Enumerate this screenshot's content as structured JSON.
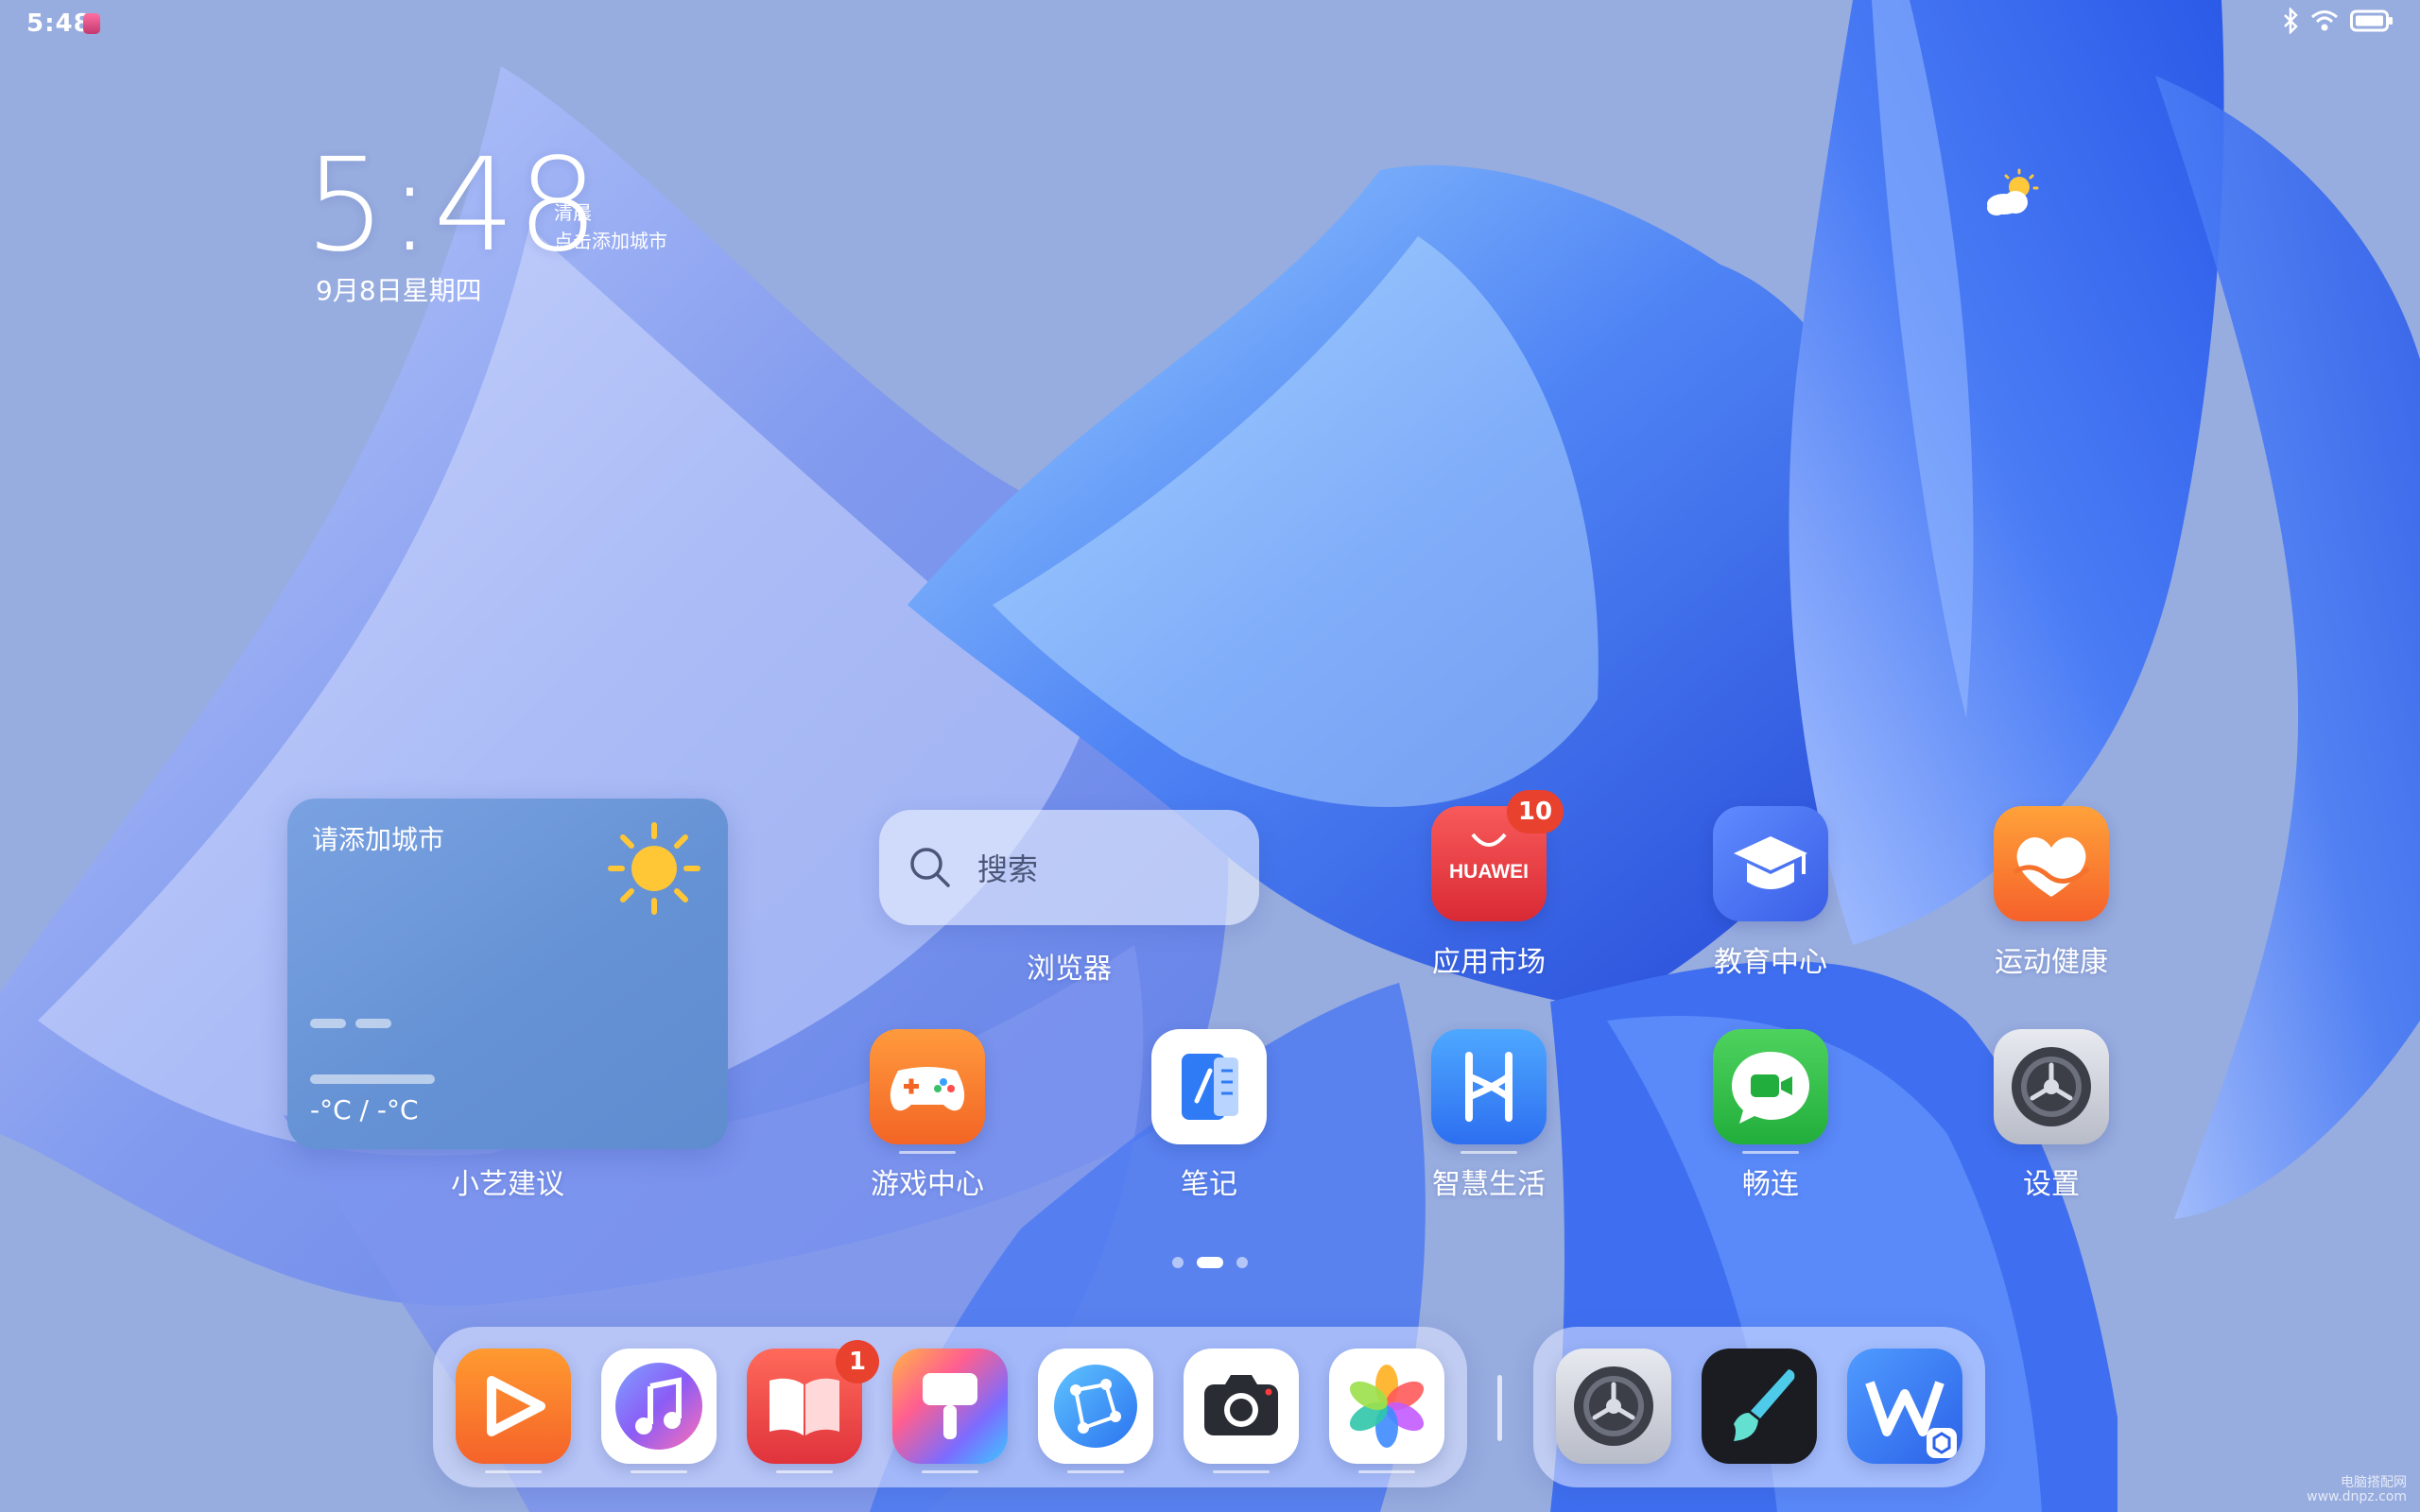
{
  "status_bar": {
    "time": "5:48"
  },
  "clock_widget": {
    "time": "5:48",
    "weather_condition": "清晨",
    "add_city_prompt": "点击添加城市",
    "date": "9月8日星期四"
  },
  "weather_card": {
    "city_prompt": "请添加城市",
    "temperature": "-°C / -°C",
    "label": "小艺建议"
  },
  "search_widget": {
    "placeholder": "搜索",
    "label": "浏览器"
  },
  "apps": {
    "app_market": {
      "label": "应用市场",
      "badge": "10",
      "brand": "HUAWEI"
    },
    "education": {
      "label": "教育中心"
    },
    "health": {
      "label": "运动健康"
    },
    "game_center": {
      "label": "游戏中心"
    },
    "notes": {
      "label": "笔记"
    },
    "smart_life": {
      "label": "智慧生活"
    },
    "meetime": {
      "label": "畅连"
    },
    "settings": {
      "label": "设置"
    }
  },
  "page_indicator": {
    "pages": 3,
    "current": 2
  },
  "dock": {
    "apps": [
      {
        "name": "video-app-icon",
        "badge": ""
      },
      {
        "name": "music-app-icon",
        "badge": ""
      },
      {
        "name": "books-app-icon",
        "badge": "1"
      },
      {
        "name": "themes-app-icon",
        "badge": ""
      },
      {
        "name": "browser-app-icon",
        "badge": ""
      },
      {
        "name": "camera-app-icon",
        "badge": ""
      },
      {
        "name": "gallery-app-icon",
        "badge": ""
      }
    ],
    "recent": [
      {
        "name": "settings-dock-icon"
      },
      {
        "name": "paint-app-icon"
      },
      {
        "name": "wps-office-icon"
      }
    ]
  },
  "watermark": {
    "line1": "电脑搭配网",
    "line2": "www.dnpz.com"
  },
  "colors": {
    "wallpaper_base": "#97acdf",
    "petal_blue": "#3a6ff0",
    "badge_red": "#e8412e"
  }
}
